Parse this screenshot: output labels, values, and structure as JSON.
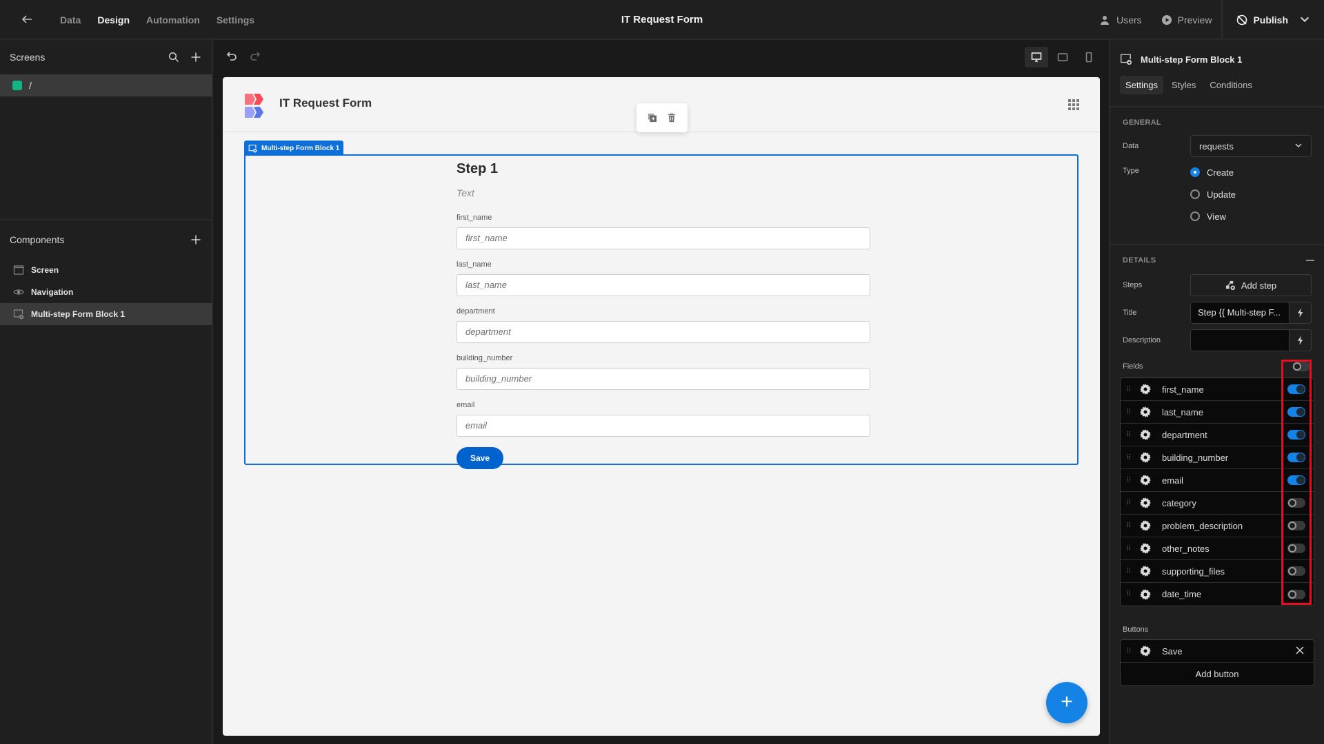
{
  "topbar": {
    "nav_tabs": [
      {
        "label": "Data",
        "active": false
      },
      {
        "label": "Design",
        "active": true
      },
      {
        "label": "Automation",
        "active": false
      },
      {
        "label": "Settings",
        "active": false
      }
    ],
    "app_title": "IT Request Form",
    "users_label": "Users",
    "preview_label": "Preview",
    "publish_label": "Publish"
  },
  "left_panel": {
    "screens_title": "Screens",
    "screens": [
      {
        "route": "/",
        "color": "#12b386"
      }
    ],
    "components_title": "Components",
    "components": [
      {
        "label": "Screen",
        "icon": "screen-icon",
        "selected": false
      },
      {
        "label": "Navigation",
        "icon": "eye-icon",
        "selected": false
      },
      {
        "label": "Multi-step Form Block 1",
        "icon": "form-block-icon",
        "selected": true
      }
    ]
  },
  "canvas": {
    "app_title": "IT Request Form",
    "block_tag": "Multi-step Form Block 1",
    "step_title": "Step 1",
    "step_description": "Text",
    "fields": [
      {
        "label": "first_name",
        "placeholder": "first_name"
      },
      {
        "label": "last_name",
        "placeholder": "last_name"
      },
      {
        "label": "department",
        "placeholder": "department"
      },
      {
        "label": "building_number",
        "placeholder": "building_number"
      },
      {
        "label": "email",
        "placeholder": "email"
      }
    ],
    "save_label": "Save",
    "fab_label": "+"
  },
  "right_panel": {
    "component_name": "Multi-step Form Block 1",
    "tabs": [
      {
        "label": "Settings",
        "active": true
      },
      {
        "label": "Styles",
        "active": false
      },
      {
        "label": "Conditions",
        "active": false
      }
    ],
    "general": {
      "title": "GENERAL",
      "data_label": "Data",
      "data_value": "requests",
      "type_label": "Type",
      "type_options": [
        {
          "label": "Create",
          "selected": true
        },
        {
          "label": "Update",
          "selected": false
        },
        {
          "label": "View",
          "selected": false
        }
      ]
    },
    "details": {
      "title": "DETAILS",
      "steps_label": "Steps",
      "add_step_label": "Add step",
      "title_label": "Title",
      "title_value": "Step {{ Multi-step F...",
      "description_label": "Description",
      "description_value": "",
      "fields_label": "Fields",
      "fields_all_enabled": false,
      "fields": [
        {
          "name": "first_name",
          "enabled": true
        },
        {
          "name": "last_name",
          "enabled": true
        },
        {
          "name": "department",
          "enabled": true
        },
        {
          "name": "building_number",
          "enabled": true
        },
        {
          "name": "email",
          "enabled": true
        },
        {
          "name": "category",
          "enabled": false
        },
        {
          "name": "problem_description",
          "enabled": false
        },
        {
          "name": "other_notes",
          "enabled": false
        },
        {
          "name": "supporting_files",
          "enabled": false
        },
        {
          "name": "date_time",
          "enabled": false
        }
      ],
      "buttons_label": "Buttons",
      "buttons": [
        {
          "label": "Save"
        }
      ],
      "add_button_label": "Add button"
    }
  },
  "colors": {
    "accent": "#1582e6",
    "block_outline": "#0f6fd9",
    "highlight": "#e3111f",
    "screen_dot": "#12b386"
  }
}
